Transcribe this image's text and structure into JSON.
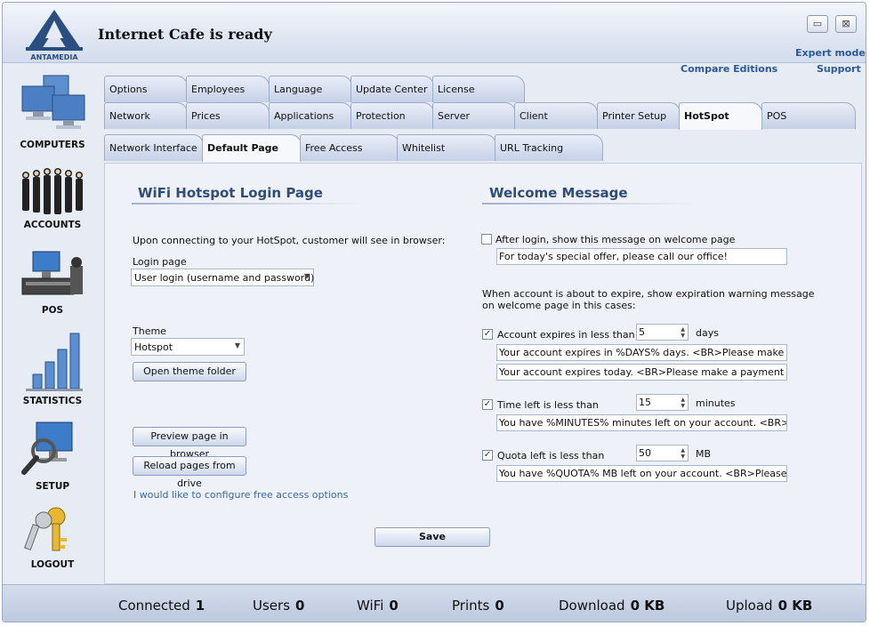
{
  "header": {
    "brand": "ANTAMEDIA",
    "title": "Internet Cafe is ready",
    "minimize_glyph": "▭",
    "close_glyph": "⊠",
    "expert_mode": "Expert mode",
    "compare_editions": "Compare Editions",
    "support": "Support"
  },
  "sidebar": {
    "items": [
      {
        "label": "COMPUTERS",
        "icon": "computers-icon"
      },
      {
        "label": "ACCOUNTS",
        "icon": "accounts-icon"
      },
      {
        "label": "POS",
        "icon": "pos-icon"
      },
      {
        "label": "STATISTICS",
        "icon": "statistics-icon"
      },
      {
        "label": "SETUP",
        "icon": "setup-icon"
      },
      {
        "label": "LOGOUT",
        "icon": "logout-icon"
      }
    ]
  },
  "tabs": {
    "row1": [
      "Options",
      "Employees",
      "Language",
      "Update Center",
      "License"
    ],
    "row2": [
      "Network",
      "Prices",
      "Applications",
      "Protection",
      "Server",
      "Client",
      "Printer Setup",
      "HotSpot",
      "POS"
    ],
    "row3": [
      "Network Interface",
      "Default Page",
      "Free Access",
      "Whitelist",
      "URL Tracking"
    ],
    "active_row2": "HotSpot",
    "active_row3": "Default Page"
  },
  "left": {
    "title": "WiFi Hotspot Login Page",
    "intro": "Upon connecting to your HotSpot, customer will see in browser:",
    "login_page_label": "Login page",
    "login_page_value": "User login (username and password)",
    "theme_label": "Theme",
    "theme_value": "Hotspot",
    "open_theme_folder": "Open theme folder",
    "preview_page": "Preview page in browser",
    "reload_pages": "Reload pages from drive",
    "free_access_link": "I would like to configure free access options"
  },
  "right": {
    "title": "Welcome Message",
    "after_login_label": "After login, show this message on welcome page",
    "after_login_checked": false,
    "welcome_text": "For today's special offer, please call our office!",
    "expire_intro_line1": "When account is about to expire, show expiration warning message",
    "expire_intro_line2": "on welcome page in this cases:",
    "account_expires_label": "Account expires in less than",
    "account_expires_checked": true,
    "account_expires_value": "5",
    "account_expires_unit": "days",
    "account_expires_msg1": "Your account expires in %DAYS% days. <BR>Please make a payment",
    "account_expires_msg2": "Your account expires today. <BR>Please make a payment to continue",
    "time_left_label": "Time left is less than",
    "time_left_checked": true,
    "time_left_value": "15",
    "time_left_unit": "minutes",
    "time_left_msg": "You have %MINUTES% minutes left on your account. <BR>Please make",
    "quota_label": "Quota left is less than",
    "quota_checked": true,
    "quota_value": "50",
    "quota_unit": "MB",
    "quota_msg": "You have %QUOTA% MB left on your account. <BR>Please make a payment"
  },
  "save_label": "Save",
  "status": {
    "connected_label": "Connected",
    "connected_value": "1",
    "users_label": "Users",
    "users_value": "0",
    "wifi_label": "WiFi",
    "wifi_value": "0",
    "prints_label": "Prints",
    "prints_value": "0",
    "download_label": "Download",
    "download_value": "0 KB",
    "upload_label": "Upload",
    "upload_value": "0 KB"
  },
  "colors": {
    "accent": "#2f4d78",
    "link": "#2a5a9e",
    "tab_active": "#f6f8fc"
  }
}
